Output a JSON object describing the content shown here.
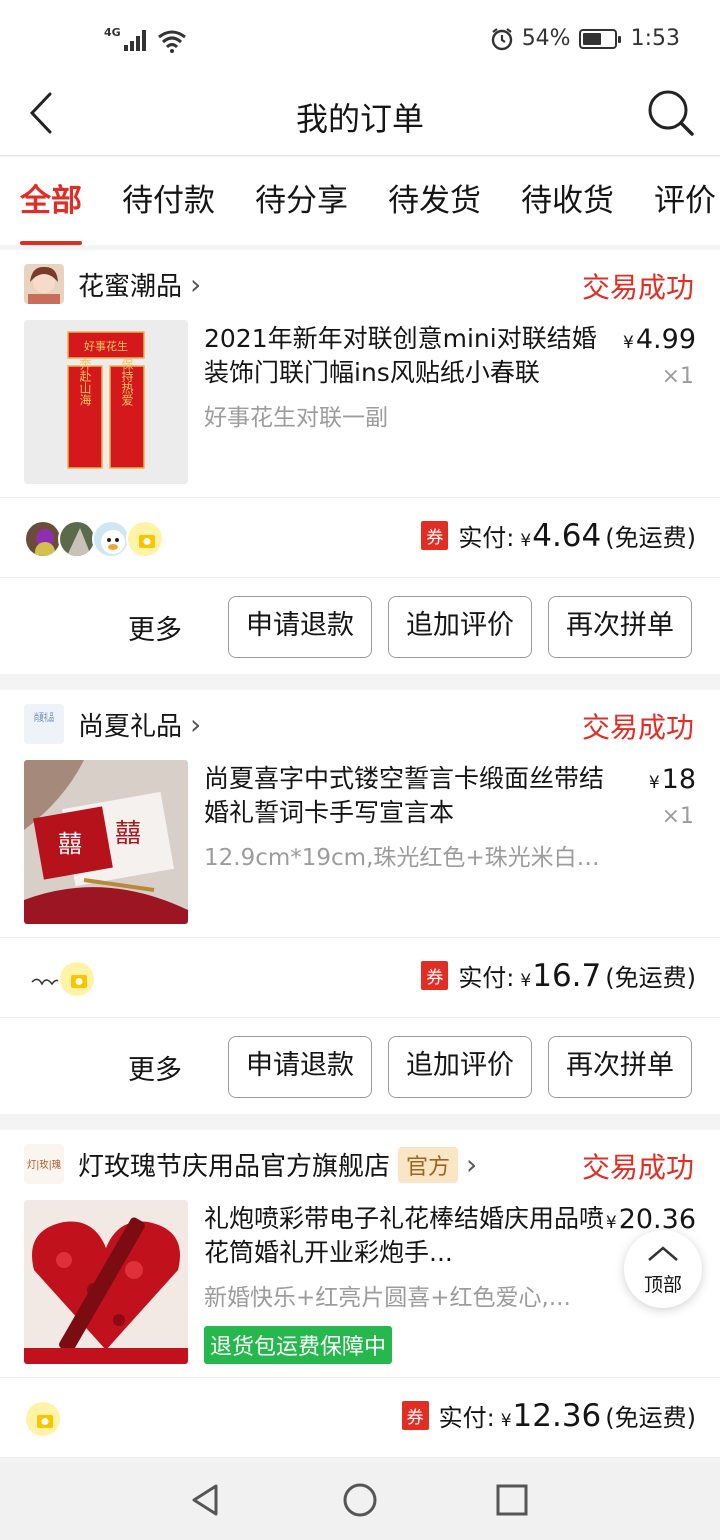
{
  "status_bar": {
    "network": "4G",
    "battery": "54%",
    "time": "1:53",
    "alarm_icon": "alarm-icon",
    "wifi_icon": "wifi-icon"
  },
  "header": {
    "title": "我的订单",
    "back_icon": "back-arrow-icon",
    "search_icon": "search-icon"
  },
  "tabs": [
    {
      "label": "全部",
      "active": true
    },
    {
      "label": "待付款"
    },
    {
      "label": "待分享"
    },
    {
      "label": "待发货"
    },
    {
      "label": "待收货"
    },
    {
      "label": "评价"
    }
  ],
  "orders": [
    {
      "shop": "花蜜潮品",
      "status": "交易成功",
      "item": {
        "title": "2021年新年对联创意mini对联结婚装饰门联门幅ins风贴纸小春联",
        "spec": "好事花生对联一副",
        "price_symbol": "¥",
        "price": "4.99",
        "qty": "×1"
      },
      "coupon": "券",
      "paid_label": "实付:",
      "yen": "¥",
      "paid": "4.64",
      "shipping": "(免运费)"
    },
    {
      "shop": "尚夏礼品",
      "shop_logo_text": "尚夏礼品",
      "status": "交易成功",
      "item": {
        "title": "尚夏喜字中式镂空誓言卡缎面丝带结婚礼誓词卡手写宣言本",
        "spec": "12.9cm*19cm,珠光红色+珠光米白+...",
        "price_symbol": "¥",
        "price": "18",
        "qty": "×1"
      },
      "coupon": "券",
      "paid_label": "实付:",
      "yen": "¥",
      "paid": "16.7",
      "shipping": "(免运费)"
    },
    {
      "shop": "灯玫瑰节庆用品官方旗舰店",
      "shop_logo_text": "灯|玫|瑰",
      "official": "官方",
      "status": "交易成功",
      "item": {
        "title": "礼炮喷彩带电子礼花棒结婚庆用品喷花筒婚礼开业彩炮手...",
        "spec": "新婚快乐+红亮片圆喜+红色爱心,...",
        "price_symbol": "¥",
        "price": "20.36",
        "qty": "×1",
        "badge": "退货包运费保障中"
      },
      "coupon": "券",
      "paid_label": "实付:",
      "yen": "¥",
      "paid": "12.36",
      "shipping": "(免运费)"
    }
  ],
  "actions": {
    "more": "更多",
    "refund": "申请退款",
    "review": "追加评价",
    "regroup": "再次拼单"
  },
  "to_top": "顶部",
  "thumb_text": {
    "couplet_top": "好事花生",
    "couplet_left": "奔赴山海",
    "couplet_right": "保持热爱",
    "xi": "囍"
  },
  "colors": {
    "accent": "#e02e24",
    "green": "#25b84c",
    "official_bg": "#fae6c4"
  }
}
